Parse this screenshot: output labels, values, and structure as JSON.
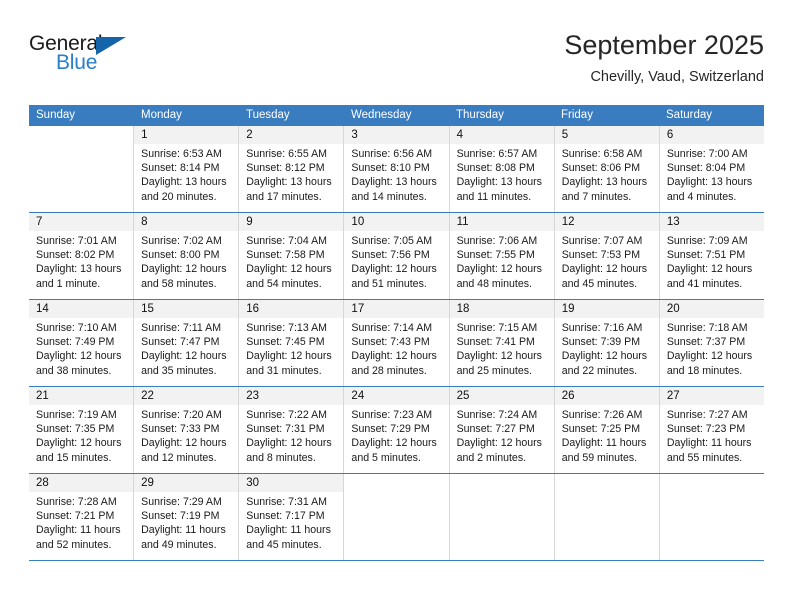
{
  "brand": {
    "name_part1": "General",
    "name_part2": "Blue",
    "accent_color": "#2a7fc9",
    "triangle_color": "#1464aa"
  },
  "header": {
    "title": "September 2025",
    "subtitle": "Chevilly, Vaud, Switzerland"
  },
  "calendar": {
    "header_bg": "#3a7cc0",
    "daynum_bg": "#f2f2f2",
    "weekdays": [
      "Sunday",
      "Monday",
      "Tuesday",
      "Wednesday",
      "Thursday",
      "Friday",
      "Saturday"
    ],
    "weeks": [
      [
        {
          "day": "",
          "sunrise": "",
          "sunset": "",
          "daylight1": "",
          "daylight2": ""
        },
        {
          "day": "1",
          "sunrise": "Sunrise: 6:53 AM",
          "sunset": "Sunset: 8:14 PM",
          "daylight1": "Daylight: 13 hours",
          "daylight2": "and 20 minutes."
        },
        {
          "day": "2",
          "sunrise": "Sunrise: 6:55 AM",
          "sunset": "Sunset: 8:12 PM",
          "daylight1": "Daylight: 13 hours",
          "daylight2": "and 17 minutes."
        },
        {
          "day": "3",
          "sunrise": "Sunrise: 6:56 AM",
          "sunset": "Sunset: 8:10 PM",
          "daylight1": "Daylight: 13 hours",
          "daylight2": "and 14 minutes."
        },
        {
          "day": "4",
          "sunrise": "Sunrise: 6:57 AM",
          "sunset": "Sunset: 8:08 PM",
          "daylight1": "Daylight: 13 hours",
          "daylight2": "and 11 minutes."
        },
        {
          "day": "5",
          "sunrise": "Sunrise: 6:58 AM",
          "sunset": "Sunset: 8:06 PM",
          "daylight1": "Daylight: 13 hours",
          "daylight2": "and 7 minutes."
        },
        {
          "day": "6",
          "sunrise": "Sunrise: 7:00 AM",
          "sunset": "Sunset: 8:04 PM",
          "daylight1": "Daylight: 13 hours",
          "daylight2": "and 4 minutes."
        }
      ],
      [
        {
          "day": "7",
          "sunrise": "Sunrise: 7:01 AM",
          "sunset": "Sunset: 8:02 PM",
          "daylight1": "Daylight: 13 hours",
          "daylight2": "and 1 minute."
        },
        {
          "day": "8",
          "sunrise": "Sunrise: 7:02 AM",
          "sunset": "Sunset: 8:00 PM",
          "daylight1": "Daylight: 12 hours",
          "daylight2": "and 58 minutes."
        },
        {
          "day": "9",
          "sunrise": "Sunrise: 7:04 AM",
          "sunset": "Sunset: 7:58 PM",
          "daylight1": "Daylight: 12 hours",
          "daylight2": "and 54 minutes."
        },
        {
          "day": "10",
          "sunrise": "Sunrise: 7:05 AM",
          "sunset": "Sunset: 7:56 PM",
          "daylight1": "Daylight: 12 hours",
          "daylight2": "and 51 minutes."
        },
        {
          "day": "11",
          "sunrise": "Sunrise: 7:06 AM",
          "sunset": "Sunset: 7:55 PM",
          "daylight1": "Daylight: 12 hours",
          "daylight2": "and 48 minutes."
        },
        {
          "day": "12",
          "sunrise": "Sunrise: 7:07 AM",
          "sunset": "Sunset: 7:53 PM",
          "daylight1": "Daylight: 12 hours",
          "daylight2": "and 45 minutes."
        },
        {
          "day": "13",
          "sunrise": "Sunrise: 7:09 AM",
          "sunset": "Sunset: 7:51 PM",
          "daylight1": "Daylight: 12 hours",
          "daylight2": "and 41 minutes."
        }
      ],
      [
        {
          "day": "14",
          "sunrise": "Sunrise: 7:10 AM",
          "sunset": "Sunset: 7:49 PM",
          "daylight1": "Daylight: 12 hours",
          "daylight2": "and 38 minutes."
        },
        {
          "day": "15",
          "sunrise": "Sunrise: 7:11 AM",
          "sunset": "Sunset: 7:47 PM",
          "daylight1": "Daylight: 12 hours",
          "daylight2": "and 35 minutes."
        },
        {
          "day": "16",
          "sunrise": "Sunrise: 7:13 AM",
          "sunset": "Sunset: 7:45 PM",
          "daylight1": "Daylight: 12 hours",
          "daylight2": "and 31 minutes."
        },
        {
          "day": "17",
          "sunrise": "Sunrise: 7:14 AM",
          "sunset": "Sunset: 7:43 PM",
          "daylight1": "Daylight: 12 hours",
          "daylight2": "and 28 minutes."
        },
        {
          "day": "18",
          "sunrise": "Sunrise: 7:15 AM",
          "sunset": "Sunset: 7:41 PM",
          "daylight1": "Daylight: 12 hours",
          "daylight2": "and 25 minutes."
        },
        {
          "day": "19",
          "sunrise": "Sunrise: 7:16 AM",
          "sunset": "Sunset: 7:39 PM",
          "daylight1": "Daylight: 12 hours",
          "daylight2": "and 22 minutes."
        },
        {
          "day": "20",
          "sunrise": "Sunrise: 7:18 AM",
          "sunset": "Sunset: 7:37 PM",
          "daylight1": "Daylight: 12 hours",
          "daylight2": "and 18 minutes."
        }
      ],
      [
        {
          "day": "21",
          "sunrise": "Sunrise: 7:19 AM",
          "sunset": "Sunset: 7:35 PM",
          "daylight1": "Daylight: 12 hours",
          "daylight2": "and 15 minutes."
        },
        {
          "day": "22",
          "sunrise": "Sunrise: 7:20 AM",
          "sunset": "Sunset: 7:33 PM",
          "daylight1": "Daylight: 12 hours",
          "daylight2": "and 12 minutes."
        },
        {
          "day": "23",
          "sunrise": "Sunrise: 7:22 AM",
          "sunset": "Sunset: 7:31 PM",
          "daylight1": "Daylight: 12 hours",
          "daylight2": "and 8 minutes."
        },
        {
          "day": "24",
          "sunrise": "Sunrise: 7:23 AM",
          "sunset": "Sunset: 7:29 PM",
          "daylight1": "Daylight: 12 hours",
          "daylight2": "and 5 minutes."
        },
        {
          "day": "25",
          "sunrise": "Sunrise: 7:24 AM",
          "sunset": "Sunset: 7:27 PM",
          "daylight1": "Daylight: 12 hours",
          "daylight2": "and 2 minutes."
        },
        {
          "day": "26",
          "sunrise": "Sunrise: 7:26 AM",
          "sunset": "Sunset: 7:25 PM",
          "daylight1": "Daylight: 11 hours",
          "daylight2": "and 59 minutes."
        },
        {
          "day": "27",
          "sunrise": "Sunrise: 7:27 AM",
          "sunset": "Sunset: 7:23 PM",
          "daylight1": "Daylight: 11 hours",
          "daylight2": "and 55 minutes."
        }
      ],
      [
        {
          "day": "28",
          "sunrise": "Sunrise: 7:28 AM",
          "sunset": "Sunset: 7:21 PM",
          "daylight1": "Daylight: 11 hours",
          "daylight2": "and 52 minutes."
        },
        {
          "day": "29",
          "sunrise": "Sunrise: 7:29 AM",
          "sunset": "Sunset: 7:19 PM",
          "daylight1": "Daylight: 11 hours",
          "daylight2": "and 49 minutes."
        },
        {
          "day": "30",
          "sunrise": "Sunrise: 7:31 AM",
          "sunset": "Sunset: 7:17 PM",
          "daylight1": "Daylight: 11 hours",
          "daylight2": "and 45 minutes."
        },
        {
          "day": "",
          "sunrise": "",
          "sunset": "",
          "daylight1": "",
          "daylight2": ""
        },
        {
          "day": "",
          "sunrise": "",
          "sunset": "",
          "daylight1": "",
          "daylight2": ""
        },
        {
          "day": "",
          "sunrise": "",
          "sunset": "",
          "daylight1": "",
          "daylight2": ""
        },
        {
          "day": "",
          "sunrise": "",
          "sunset": "",
          "daylight1": "",
          "daylight2": ""
        }
      ]
    ]
  }
}
